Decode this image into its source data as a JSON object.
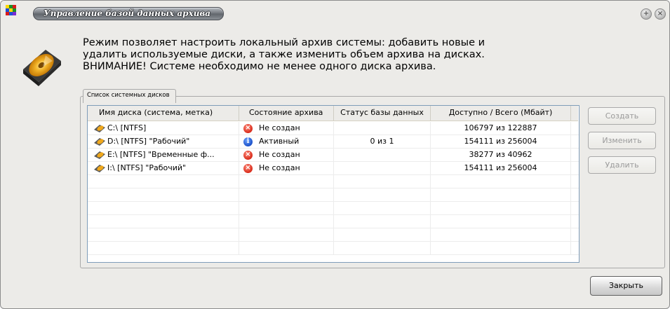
{
  "window": {
    "title": "Управление базой данных архива",
    "colors": {
      "title_pill": "#6f7379",
      "frame_bg": "#ecebe8",
      "list_border": "#7f9db9",
      "error": "#d82b1a",
      "info": "#1a4fc8"
    }
  },
  "description": {
    "line1": "Режим позволяет настроить локальный архив системы: добавить новые и",
    "line2": "удалить используемые диски, а также изменить объем архива на дисках.",
    "line3": "ВНИМАНИЕ! Системе необходимо не менее одного диска архива."
  },
  "group": {
    "title": "Список системных дисков"
  },
  "table": {
    "columns": [
      "Имя диска (система, метка)",
      "Состояние архива",
      "Статус базы данных",
      "Доступно / Всего (Мбайт)"
    ],
    "rows": [
      {
        "name": "C:\\  [NTFS]",
        "state": "Не создан",
        "state_icon": "error-icon",
        "db_status": "",
        "space": "106797 из 122887"
      },
      {
        "name": "D:\\  [NTFS]   \"Рабочий\"",
        "state": "Активный",
        "state_icon": "info-icon",
        "db_status": "0 из 1",
        "space": "154111 из 256004"
      },
      {
        "name": "E:\\  [NTFS]   \"Временные ф...",
        "state": "Не создан",
        "state_icon": "error-icon",
        "db_status": "",
        "space": "38277 из 40962"
      },
      {
        "name": "I:\\   [NTFS]  \"Рабочий\"",
        "state": "Не создан",
        "state_icon": "error-icon",
        "db_status": "",
        "space": "154111 из 256004"
      }
    ]
  },
  "buttons": {
    "create": "Создать",
    "edit": "Изменить",
    "delete": "Удалить",
    "close": "Закрыть"
  }
}
